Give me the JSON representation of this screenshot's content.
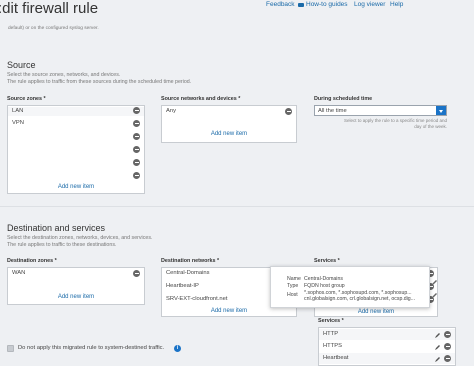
{
  "header": {
    "title": ":dit firewall rule",
    "feedback": "Feedback",
    "howto": "How-to guides",
    "logviewer": "Log viewer",
    "help": "Help"
  },
  "top_note": "default) or on the configured syslog server.",
  "source": {
    "title": "Source",
    "desc1": "Select the source zones, networks, and devices.",
    "desc2": "The rule applies to traffic from these sources during the scheduled time period.",
    "zones_label": "Source zones *",
    "zones": [
      "LAN",
      "VPN"
    ],
    "zones_add": "Add new item",
    "networks_label": "Source networks and devices *",
    "networks": [
      "Any"
    ],
    "networks_add": "Add new item",
    "schedule_label": "During scheduled time",
    "schedule_value": "All the time",
    "schedule_hint1": "Select to apply the rule to a specific time period and",
    "schedule_hint2": "day of the week."
  },
  "destination": {
    "title": "Destination and services",
    "desc1": "Select the destination zones, networks, devices, and services.",
    "desc2": "The rule applies to traffic to these destinations.",
    "zones_label": "Destination zones *",
    "zones": [
      "WAN"
    ],
    "zones_add": "Add new item",
    "networks_label": "Destination networks *",
    "networks": [
      "Central-Domains",
      "Heartbeat-IP",
      "SRV-EXT-cloudfront.net"
    ],
    "networks_add": "Add new item",
    "services_label": "Services *",
    "services_add": "Add new item"
  },
  "tooltip": {
    "name_key": "Name",
    "name_val": "Central-Domains",
    "type_key": "Type",
    "type_val": "FQDN host group",
    "host_key": "Host",
    "host_val1": "*.sophos.com, *.sophosupd.com, *.sophosup...",
    "host_val2": "cnl.globalsign.com, crl.globalsign.net, ocsp.dig..."
  },
  "services_dropdown": {
    "label": "Services *",
    "items": [
      "HTTP",
      "HTTPS",
      "Heartbeat"
    ]
  },
  "footer": {
    "checkbox_label": "Do not apply this migrated rule to system-destined traffic.",
    "info": "i"
  }
}
